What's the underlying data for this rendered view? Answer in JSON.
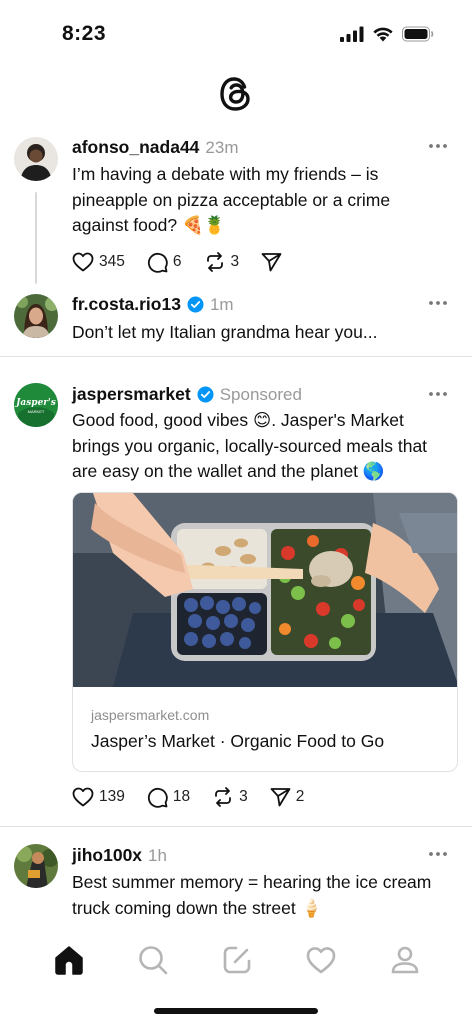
{
  "status_bar": {
    "time": "8:23"
  },
  "feed": {
    "posts": [
      {
        "username": "afonso_nada44",
        "time": "23m",
        "text": "I’m having a debate with my friends – is pineapple on pizza acceptable or a crime against food? 🍕🍍",
        "likes": "345",
        "replies": "6",
        "reposts": "3"
      },
      {
        "username": "fr.costa.rio13",
        "time": "1m",
        "verified": true,
        "text": "Don’t let my Italian grandma hear you..."
      },
      {
        "username": "jaspersmarket",
        "verified": true,
        "label": "Sponsored",
        "avatar_text": "Jasper's",
        "avatar_subtext": "MARKET",
        "text": "Good food, good vibes 😊. Jasper's Market brings you organic, locally-sourced meals that are easy on the wallet and the planet 🌎",
        "link": {
          "domain": "jaspersmarket.com",
          "title": "Jasper’s Market · Organic Food to Go"
        },
        "likes": "139",
        "replies": "18",
        "reposts": "3",
        "shares": "2"
      },
      {
        "username": "jiho100x",
        "time": "1h",
        "text": "Best summer memory = hearing the ice cream truck coming down the street 🍦"
      }
    ]
  },
  "tab_bar": {
    "tabs": [
      "home-icon",
      "search-icon",
      "compose-icon",
      "activity-icon",
      "profile-icon"
    ],
    "active": "home-icon"
  },
  "colors": {
    "verified": "#0095f6",
    "brand_green": "#1f8a3a",
    "muted": "#999999"
  }
}
